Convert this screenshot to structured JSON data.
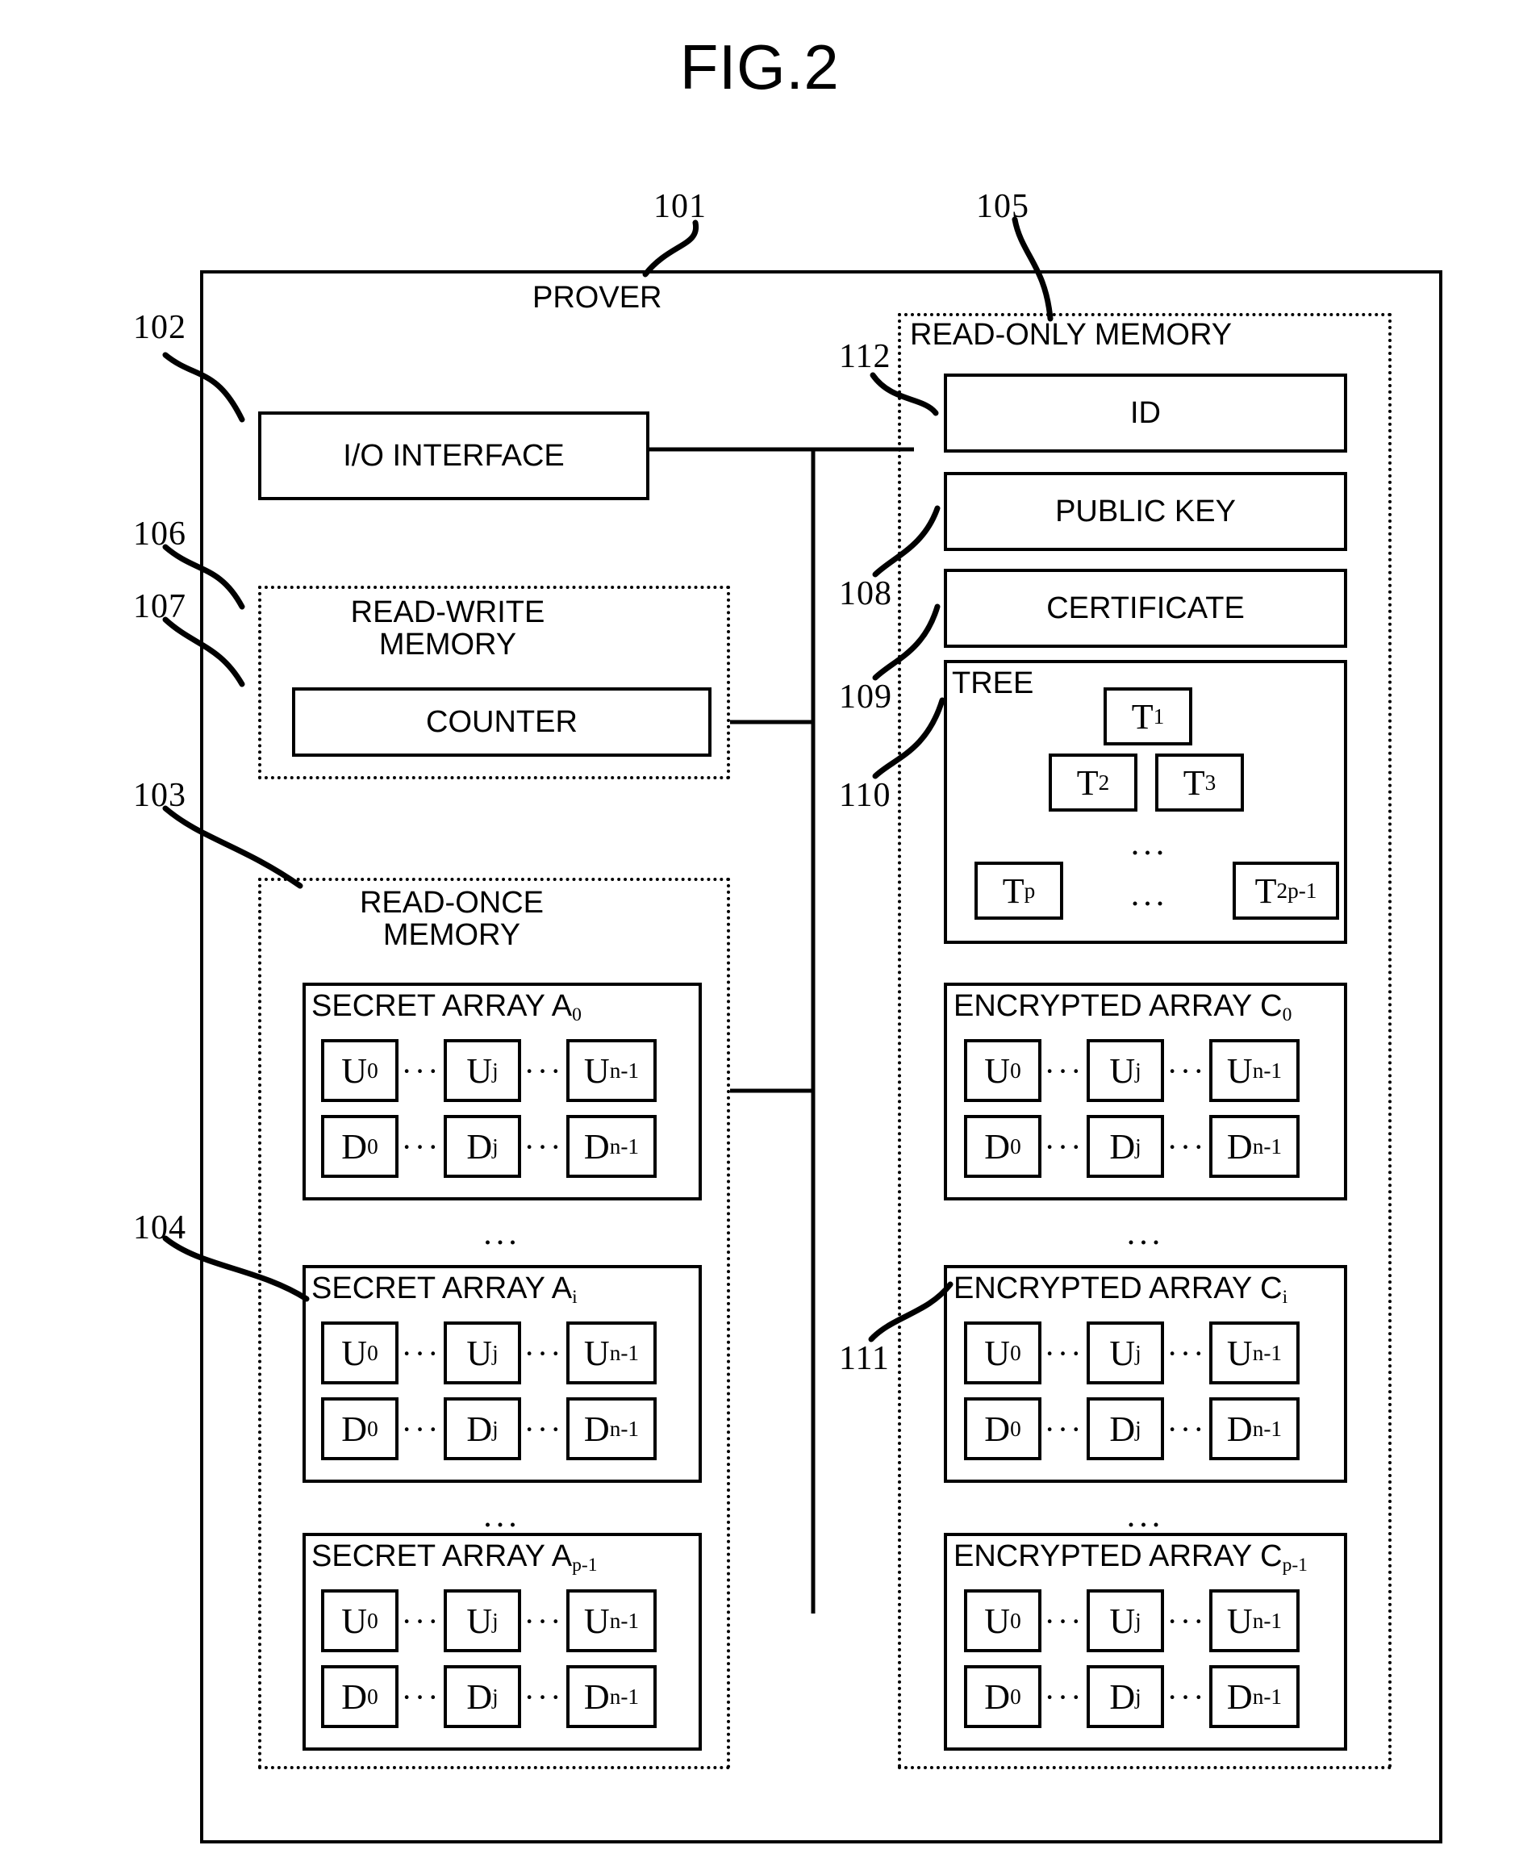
{
  "figure": {
    "title": "FIG.2"
  },
  "prover": {
    "label": "PROVER",
    "ref": "101"
  },
  "io_interface": {
    "label": "I/O INTERFACE",
    "ref": "102"
  },
  "read_write_memory": {
    "label_line1": "READ-WRITE",
    "label_line2": "MEMORY",
    "ref": "106",
    "counter": {
      "label": "COUNTER",
      "ref": "107"
    }
  },
  "read_once_memory": {
    "label_line1": "READ-ONCE",
    "label_line2": "MEMORY",
    "ref": "103",
    "array_ref": "104",
    "ellipsis": "...",
    "arrays": [
      {
        "title_prefix": "SECRET ARRAY A",
        "title_sub": "0",
        "row_u": [
          "U",
          "U",
          "U"
        ],
        "row_u_subs": [
          "0",
          "j",
          "n-1"
        ],
        "row_d": [
          "D",
          "D",
          "D"
        ],
        "row_d_subs": [
          "0",
          "j",
          "n-1"
        ]
      },
      {
        "title_prefix": "SECRET ARRAY A",
        "title_sub": "i",
        "row_u": [
          "U",
          "U",
          "U"
        ],
        "row_u_subs": [
          "0",
          "j",
          "n-1"
        ],
        "row_d": [
          "D",
          "D",
          "D"
        ],
        "row_d_subs": [
          "0",
          "j",
          "n-1"
        ]
      },
      {
        "title_prefix": "SECRET ARRAY A",
        "title_sub": "p-1",
        "row_u": [
          "U",
          "U",
          "U"
        ],
        "row_u_subs": [
          "0",
          "j",
          "n-1"
        ],
        "row_d": [
          "D",
          "D",
          "D"
        ],
        "row_d_subs": [
          "0",
          "j",
          "n-1"
        ]
      }
    ]
  },
  "read_only_memory": {
    "label": "READ-ONLY MEMORY",
    "ref": "105",
    "id": {
      "label": "ID",
      "ref": "112"
    },
    "public_key": {
      "label": "PUBLIC KEY",
      "ref": "108"
    },
    "certificate": {
      "label": "CERTIFICATE",
      "ref": "109"
    },
    "tree": {
      "label": "TREE",
      "ref": "110",
      "ellipsis": "...",
      "nodes": [
        {
          "base": "T",
          "sub": "1"
        },
        {
          "base": "T",
          "sub": "2"
        },
        {
          "base": "T",
          "sub": "3"
        },
        {
          "base": "T",
          "sub": "p"
        },
        {
          "base": "T",
          "sub": "2p-1"
        }
      ]
    },
    "encrypted_ref": "111",
    "ellipsis": "...",
    "arrays": [
      {
        "title_prefix": "ENCRYPTED ARRAY C",
        "title_sub": "0",
        "row_u": [
          "U",
          "U",
          "U"
        ],
        "row_u_subs": [
          "0",
          "j",
          "n-1"
        ],
        "row_d": [
          "D",
          "D",
          "D"
        ],
        "row_d_subs": [
          "0",
          "j",
          "n-1"
        ]
      },
      {
        "title_prefix": "ENCRYPTED ARRAY C",
        "title_sub": "i",
        "row_u": [
          "U",
          "U",
          "U"
        ],
        "row_u_subs": [
          "0",
          "j",
          "n-1"
        ],
        "row_d": [
          "D",
          "D",
          "D"
        ],
        "row_d_subs": [
          "0",
          "j",
          "n-1"
        ]
      },
      {
        "title_prefix": "ENCRYPTED ARRAY C",
        "title_sub": "p-1",
        "row_u": [
          "U",
          "U",
          "U"
        ],
        "row_u_subs": [
          "0",
          "j",
          "n-1"
        ],
        "row_d": [
          "D",
          "D",
          "D"
        ],
        "row_d_subs": [
          "0",
          "j",
          "n-1"
        ]
      }
    ]
  },
  "colors": {
    "stroke": "#000000",
    "background": "#ffffff"
  }
}
